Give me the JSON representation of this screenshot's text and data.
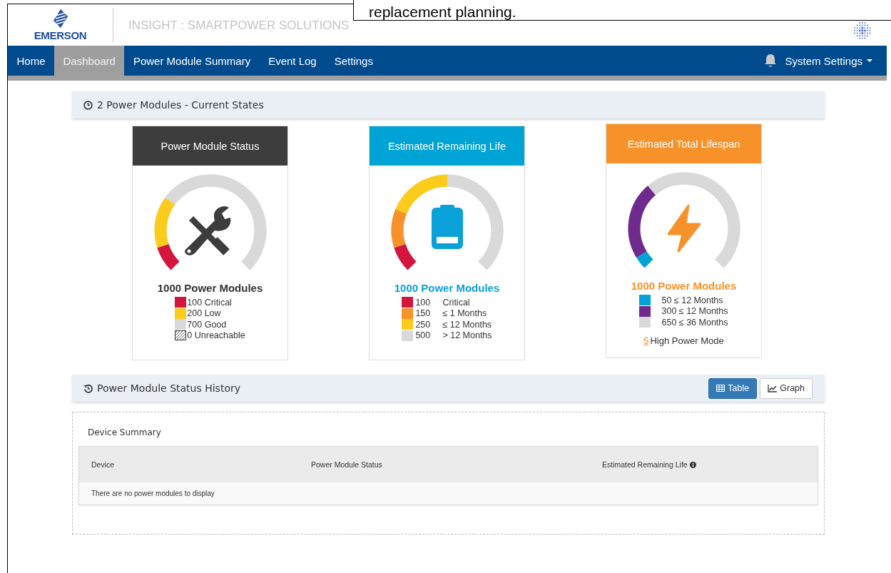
{
  "callout": {
    "text": "replacement planning."
  },
  "header": {
    "logo": "EMERSON",
    "title": "INSIGHT : SMARTPOWER SOLUTIONS"
  },
  "nav": {
    "items": [
      {
        "label": "Home",
        "selected": false
      },
      {
        "label": "Dashboard",
        "selected": true
      },
      {
        "label": "Power Module Summary",
        "selected": false
      },
      {
        "label": "Event Log",
        "selected": false
      },
      {
        "label": "Settings",
        "selected": false
      }
    ],
    "system_settings": "System Settings"
  },
  "states_panel": {
    "title": "2 Power Modules - Current States"
  },
  "cards": [
    {
      "kind": "status",
      "title": "Power Module Status",
      "total": "1000 Power Modules",
      "legend": [
        {
          "kind": "solid",
          "color": "#d4163f",
          "text": "100 Critical"
        },
        {
          "kind": "solid",
          "color": "#fccc1d",
          "text": "200 Low"
        },
        {
          "kind": "solid",
          "color": "#d9d9d9",
          "text": "700 Good"
        },
        {
          "kind": "hatched",
          "text": "0 Unreachable"
        }
      ]
    },
    {
      "kind": "remaining",
      "title": "Estimated Remaining Life",
      "total": "1000 Power Modules",
      "legend": [
        {
          "kind": "solid",
          "color": "#d4163f",
          "count": "100",
          "label": "Critical"
        },
        {
          "kind": "solid",
          "color": "#f7922a",
          "count": "150",
          "label": "≤ 1 Months"
        },
        {
          "kind": "solid",
          "color": "#fccc1d",
          "count": "250",
          "label": "≤ 12 Months"
        },
        {
          "kind": "solid",
          "color": "#d9d9d9",
          "count": "500",
          "label": "> 12 Months"
        }
      ]
    },
    {
      "kind": "lifespan",
      "title": "Estimated Total Lifespan",
      "total": "1000 Power Modules",
      "legend": [
        {
          "kind": "solid",
          "color": "#00a3d6",
          "text": "50 ≤ 12 Months"
        },
        {
          "kind": "solid",
          "color": "#6e2a8d",
          "text": "300 ≤ 12 Months"
        },
        {
          "kind": "solid",
          "color": "#d9d9d9",
          "text": "650 ≤ 36 Months"
        }
      ],
      "footer": {
        "link": "5",
        "text": "High Power Mode"
      }
    }
  ],
  "history_panel": {
    "title": "Power Module Status History",
    "views": [
      {
        "label": "Table",
        "selected": true
      },
      {
        "label": "Graph",
        "selected": false
      }
    ]
  },
  "device_summary": {
    "title": "Device Summary",
    "columns": [
      "Device",
      "Power Module Status",
      "Estimated Remaining Life"
    ],
    "empty_message": "There are no power modules to display"
  }
}
